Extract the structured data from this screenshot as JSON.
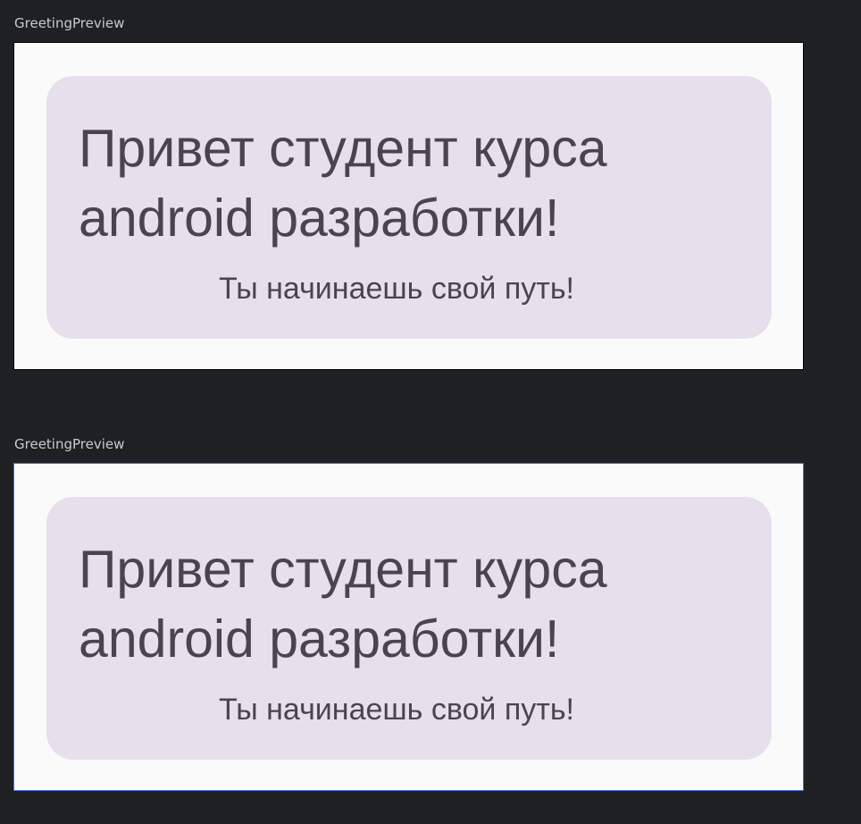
{
  "previews": [
    {
      "label": "GreetingPreview",
      "title_line1": "Привет студент курса",
      "title_line2": "android разработки!",
      "subtitle": "Ты начинаешь свой путь!"
    },
    {
      "label": "GreetingPreview",
      "title_line1": "Привет студент курса",
      "title_line2": "android разработки!",
      "subtitle": "Ты начинаешь свой путь!"
    }
  ],
  "colors": {
    "background": "#1f2024",
    "label_text": "#c9cacf",
    "frame_background": "#fafafb",
    "card_background": "#e7dfec",
    "card_text": "#49454f",
    "selected_border": "#4a6fe0"
  }
}
